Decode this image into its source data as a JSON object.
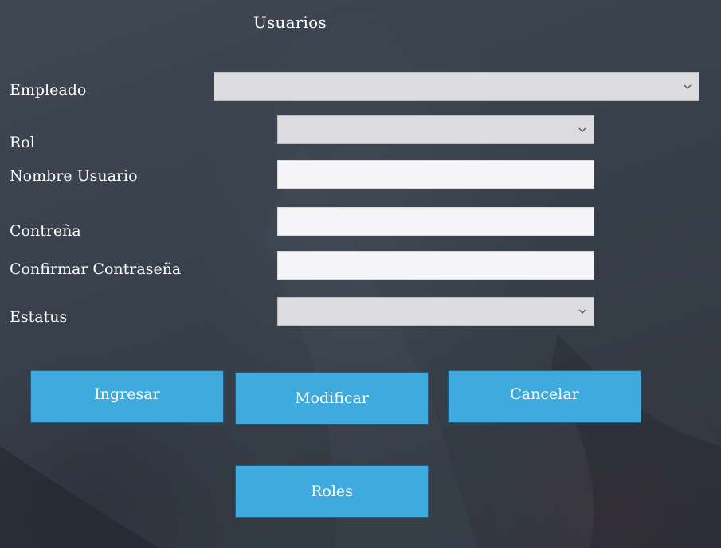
{
  "form": {
    "title": "Usuarios",
    "fields": {
      "empleado": {
        "label": "Empleado",
        "value": ""
      },
      "rol": {
        "label": "Rol",
        "value": ""
      },
      "nombre_usuario": {
        "label": "Nombre Usuario",
        "value": ""
      },
      "contrasena": {
        "label": "Contreña",
        "value": ""
      },
      "confirmar_contrasena": {
        "label": "Confirmar Contraseña",
        "value": ""
      },
      "estatus": {
        "label": "Estatus",
        "value": ""
      }
    }
  },
  "buttons": {
    "ingresar": "Ingresar",
    "modificar": "Modificar",
    "cancelar": "Cancelar",
    "roles": "Roles"
  },
  "icons": {
    "dropdown": "chevron-down-icon"
  },
  "colors": {
    "background": "#3a424d",
    "button": "#3faadd",
    "button_border": "#1c5f86",
    "select_bg": "#dcdcde",
    "input_bg": "#f5f5f7",
    "text": "#ffffff"
  }
}
